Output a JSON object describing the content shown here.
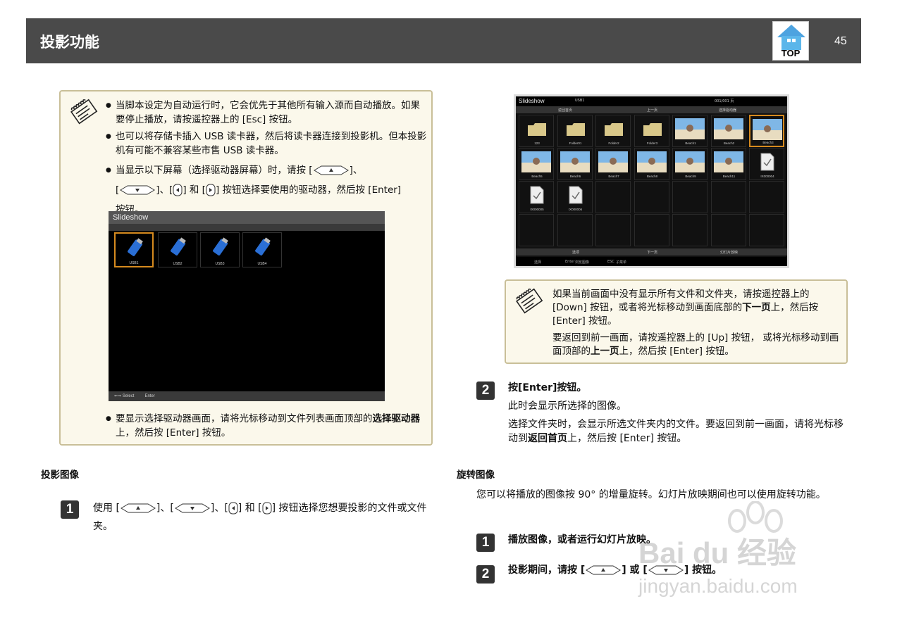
{
  "header": {
    "title": "投影功能",
    "top_label": "TOP",
    "page_number": "45"
  },
  "note1": {
    "items": [
      "当脚本设定为自动运行时，它会优先于其他所有输入源而自动播放。如果要停止播放，请按遥控器上的 [Esc] 按钮。",
      "也可以将存储卡插入 USB 读卡器，然后将读卡器连接到投影机。但本投影机有可能不兼容某些市售 USB 读卡器。"
    ],
    "item3_a": "当显示以下屏幕（选择驱动器屏幕）时，请按 [",
    "item3_b": "]、",
    "item3_c": "[",
    "item3_d": "]、[",
    "item3_e": "] 和 [",
    "item3_f": "] 按钮选择要使用的驱动器，然后按 [Enter]",
    "item3_g": "按钮。",
    "item4_a": "要显示选择驱动器画面，请将光标移动到文件列表画面顶部的",
    "item4_b": "选择驱动器",
    "item4_c": "上，然后按 [Enter] 按钮。"
  },
  "drive_screen": {
    "title": "Slideshow",
    "drives": [
      "USB1",
      "USB2",
      "USB3",
      "USB4"
    ],
    "footer_select": "Select",
    "footer_enter": "Enter"
  },
  "file_screen": {
    "title": "Slideshow",
    "drive_label": "USB1",
    "page_label": "001/001 页",
    "nav_top": "返回首页",
    "nav_up": "上一页",
    "nav_select_drive": "选择驱动器",
    "nav_option": "选项",
    "nav_down": "下一页",
    "nav_slideshow": "幻灯片放映",
    "foot_select": "选择",
    "foot_enter_key": "Enter",
    "foot_enter": "浏览图像",
    "foot_esc_key": "ESC",
    "foot_esc": "子菜单",
    "tiles": [
      "123",
      "Folder01",
      "Folder2",
      "Folder3",
      "Beach1",
      "Beach2",
      "Beach3",
      "Beach5",
      "Beach6",
      "Beach7",
      "Beach8",
      "Beach9",
      "Beach11",
      "IX000004",
      "IX000005",
      "IX000006"
    ]
  },
  "note2": {
    "p1_a": "如果当前画面中没有显示所有文件和文件夹，请按遥控器上的 [Down] 按钮，或者将光标移动到画面底部的",
    "p1_b": "下一页",
    "p1_c": "上，然后按 [Enter] 按钮。",
    "p2_a": "要返回到前一画面，请按遥控器上的 [Up] 按钮， 或将光标移动到画面顶部的",
    "p2_b": "上一页",
    "p2_c": "上，然后按 [Enter] 按钮。"
  },
  "right_step2": {
    "num": "2",
    "title": "按[Enter]按钮。",
    "line1": "此时会显示所选择的图像。",
    "line2_a": "选择文件夹时，会显示所选文件夹内的文件。要返回到前一画面，请将光标移动到",
    "line2_b": "返回首页",
    "line2_c": "上，然后按 [Enter] 按钮。"
  },
  "left_section": {
    "title": "投影图像",
    "step1_num": "1",
    "step1_a": "使用 [",
    "step1_b": "]、[",
    "step1_c": "]、[",
    "step1_d": "] 和 [",
    "step1_e": "] 按钮选择您想要投影的文件或文件夹。"
  },
  "right_section": {
    "title": "旋转图像",
    "intro": "您可以将播放的图像按 90° 的增量旋转。幻灯片放映期间也可以使用旋转功能。",
    "step1_num": "1",
    "step1": "播放图像，或者运行幻灯片放映。",
    "step2_num": "2",
    "step2_a": "投影期间，请按 [",
    "step2_b": "] 或 [",
    "step2_c": "] 按钮。"
  },
  "watermark": {
    "brand": "Bai du 经验",
    "url": "jingyan.baidu.com"
  }
}
